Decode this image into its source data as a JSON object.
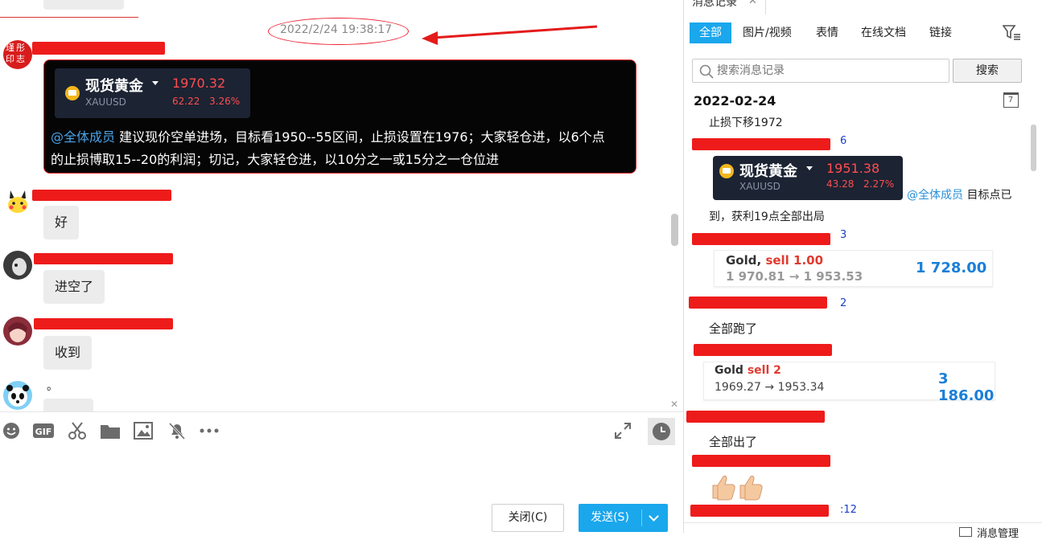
{
  "chat": {
    "timestamp": "2022/2/24 19:38:17",
    "avatar_seal_text": "瑾彤印志",
    "main_message": {
      "ticker": {
        "name": "现货黄金",
        "symbol": "XAUUSD",
        "price": "1970.32",
        "change": "62.22",
        "change_pct": "3.26%"
      },
      "mention": "@全体成员",
      "text_line1": " 建议现价空单进场，目标看1950--55区间，止损设置在1976；大家轻仓进，以6个点",
      "text_line2": "的止损博取15--20的利润；切记，大家轻仓进，以10分之一或15分之一仓位进"
    },
    "replies": [
      {
        "text": "好"
      },
      {
        "text": "进空了"
      },
      {
        "text": "收到"
      }
    ],
    "partial_text": "。",
    "buttons": {
      "close": "关闭(C)",
      "send": "发送(S)"
    },
    "accent_color": "#1aa7ec",
    "icons": [
      "emoji-icon",
      "gif-icon",
      "scissors-icon",
      "folder-icon",
      "image-icon",
      "mute-icon",
      "more-icon",
      "expand-icon",
      "history-icon"
    ]
  },
  "history": {
    "header_title": "消息记录",
    "tabs": [
      "全部",
      "图片/视频",
      "表情",
      "在线文档",
      "链接"
    ],
    "search_placeholder": "搜索消息记录",
    "search_button": "搜索",
    "date": "2022-02-24",
    "calendar_day": "7",
    "messages": {
      "m1": "止损下移1972",
      "sender1_suffix": "6",
      "ticker": {
        "name": "现货黄金",
        "symbol": "XAUUSD",
        "price": "1951.38",
        "change": "43.28",
        "change_pct": "2.27%"
      },
      "mention": "@全体成员",
      "m2a": " 目标点已",
      "m2b": "到，获利19点全部出局",
      "sender2_suffix": "3",
      "trade1": {
        "asset": "Gold,",
        "action": "sell 1.00",
        "from": "1 970.81",
        "arrow": "→",
        "to": "1 953.53",
        "profit": "1 728.00"
      },
      "sender3_suffix": "2",
      "m3": "全部跑了",
      "trade2": {
        "asset": "Gold",
        "action": "sell 2",
        "from": "1969.27",
        "arrow": "→",
        "to": "1953.34",
        "profit": "3 186.00"
      },
      "m4": "全部出了",
      "sender4_suffix": ":12",
      "footer": "消息管理"
    }
  }
}
